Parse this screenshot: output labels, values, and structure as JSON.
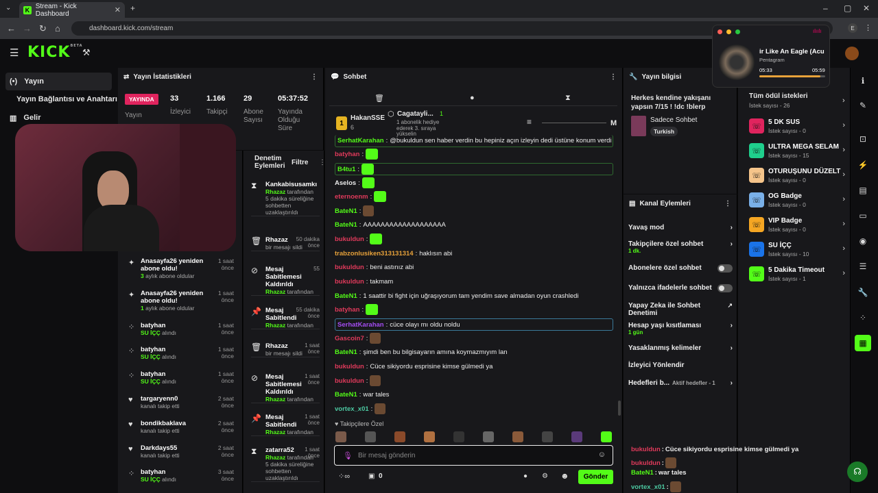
{
  "browser": {
    "tab_title": "Stream - Kick Dashboard",
    "url": "dashboard.kick.com/stream"
  },
  "app": {
    "logo": "KICK",
    "logo_badge": "BETA"
  },
  "leftnav": {
    "items": [
      {
        "label": "Yayın",
        "icon": "broadcast-icon"
      },
      {
        "label": "Yayın Bağlantısı ve Anahtarı",
        "icon": "key-icon"
      },
      {
        "label": "Gelir",
        "icon": "chart-icon"
      }
    ]
  },
  "stats": {
    "title": "Yayın İstatistikleri",
    "live_badge": "YAYINDA",
    "live_sub": "Yayın",
    "items": [
      {
        "value": "33",
        "label": "İzleyici"
      },
      {
        "value": "1.166",
        "label": "Takipçi"
      },
      {
        "value": "29",
        "label": "Abone Sayısı"
      },
      {
        "value": "05:37:52",
        "label": "Yayında Olduğu Süre"
      }
    ]
  },
  "events": [
    {
      "title": "Anasayfa26 yeniden abone oldu!",
      "sub_green": "3",
      "sub": " aylık abone oldular",
      "time": "1 saat önce",
      "icon": "sparkle-icon"
    },
    {
      "title": "Anasayfa26 yeniden abone oldu!",
      "sub_green": "1",
      "sub": " aylık abone oldular",
      "time": "1 saat önce",
      "icon": "sparkle-icon"
    },
    {
      "title": "batyhan",
      "sub_green": "SU İÇÇ",
      "sub": " alındı",
      "time": "1 saat önce",
      "icon": "reward-icon"
    },
    {
      "title": "batyhan",
      "sub_green": "SU İÇÇ",
      "sub": " alındı",
      "time": "1 saat önce",
      "icon": "reward-icon"
    },
    {
      "title": "batyhan",
      "sub_green": "SU İÇÇ",
      "sub": " alındı",
      "time": "1 saat önce",
      "icon": "reward-icon"
    },
    {
      "title": "targaryenn0",
      "sub_green": "",
      "sub": "kanalı takip etti",
      "time": "2 saat önce",
      "icon": "heart-icon"
    },
    {
      "title": "bondikbaklava",
      "sub_green": "",
      "sub": "kanalı takip etti",
      "time": "2 saat önce",
      "icon": "heart-icon"
    },
    {
      "title": "Darkdays55",
      "sub_green": "",
      "sub": "kanalı takip etti",
      "time": "2 saat önce",
      "icon": "heart-icon"
    },
    {
      "title": "batyhan",
      "sub_green": "SU İÇÇ",
      "sub": " alındı",
      "time": "3 saat önce",
      "icon": "reward-icon"
    }
  ],
  "moderation": {
    "title": "Denetim Eylemleri",
    "filter": "Filtre",
    "items": [
      {
        "icon": "hourglass-icon",
        "title": "Kankabisusamkı",
        "actor": "Rhazaz",
        "desc": " tarafından 5 dakika süreliğine sohbetten uzaklaştırıldı",
        "time": ""
      },
      {
        "icon": "trash-icon",
        "title": "Rhazaz",
        "actor": "",
        "desc": "bir mesajı sildi",
        "time": "50 dakika önce"
      },
      {
        "icon": "unpin-icon",
        "title": "Mesaj Sabitlemesi Kaldırıldı",
        "actor": "Rhazaz",
        "desc": " tarafından",
        "time": "55"
      },
      {
        "icon": "pin-icon",
        "title": "Mesaj Sabitlendi",
        "actor": "Rhazaz",
        "desc": " tarafından",
        "time": "55 dakika önce"
      },
      {
        "icon": "trash-icon",
        "title": "Rhazaz",
        "actor": "",
        "desc": "bir mesajı sildi",
        "time": "1 saat önce"
      },
      {
        "icon": "unpin-icon",
        "title": "Mesaj Sabitlemesi Kaldırıldı",
        "actor": "Rhazaz",
        "desc": " tarafından",
        "time": "1 saat önce"
      },
      {
        "icon": "pin-icon",
        "title": "Mesaj Sabitlendi",
        "actor": "Rhazaz",
        "desc": " tarafından",
        "time": "1 saat önce"
      },
      {
        "icon": "hourglass-icon",
        "title": "zatarra52",
        "actor": "Rhazaz",
        "desc": " tarafından 5 dakika süreliğine sohbetten uzaklaştırıldı",
        "time": "1 saat önce"
      }
    ]
  },
  "chat": {
    "title": "Sohbet",
    "top_user": "HakanSSE",
    "top_user_rank": "1",
    "top_user_count": "6",
    "gift_user": "Cagatayli...",
    "gift_text": "1 abonelik hediye ederek 3. sıraya yükselin",
    "gift_count": "1",
    "partial_letter": "M",
    "messages": [
      {
        "user": "SerhatKarahan",
        "color": "green",
        "text": "@bukuldun sen haber verdin bu hepiniz açın izleyin dedi üstüne konum verdi",
        "highlight": true
      },
      {
        "user": "batyhan",
        "color": "red",
        "text": "",
        "emote": true
      },
      {
        "user": "B4tu1",
        "color": "green",
        "text": "",
        "emote": true,
        "highlight": true
      },
      {
        "user": "Aselos",
        "color": "white",
        "text": "",
        "emote": true
      },
      {
        "user": "eternoenm",
        "color": "red",
        "text": "",
        "emote": true
      },
      {
        "user": "BateN1",
        "color": "green",
        "text": "",
        "avatar": true
      },
      {
        "user": "BateN1",
        "color": "green",
        "text": "AAAAAAAAAAAAAAAAAAA"
      },
      {
        "user": "bukuldun",
        "color": "red",
        "text": "",
        "emote": true
      },
      {
        "user": "trabzonlusiken313131314",
        "color": "orange",
        "text": "haklısın abi"
      },
      {
        "user": "bukuldun",
        "color": "red",
        "text": "beni astınız abi"
      },
      {
        "user": "bukuldun",
        "color": "red",
        "text": "takmam"
      },
      {
        "user": "BateN1",
        "color": "green",
        "text": "1 saattir bi fight için uğraşıyorum tam yendim save almadan oyun crashledi"
      },
      {
        "user": "batyhan",
        "color": "red",
        "text": "",
        "emote": true
      },
      {
        "user": "SerhatKarahan",
        "color": "purple",
        "text": "cüce olayı mı oldu noldu",
        "highlight": true
      },
      {
        "user": "Gascoin7",
        "color": "red",
        "text": "",
        "avatar": true
      },
      {
        "user": "BateN1",
        "color": "green",
        "text": "şimdi ben bu bilgisayarın amına koymazmıyım lan"
      },
      {
        "user": "bukuldun",
        "color": "red",
        "text": "Cüce sikiyordu esprisine kimse gülmedi ya"
      },
      {
        "user": "bukuldun",
        "color": "red",
        "text": "",
        "avatar": true
      },
      {
        "user": "BateN1",
        "color": "green",
        "text": "war tales"
      },
      {
        "user": "vortex_x01",
        "color": "teal",
        "text": "",
        "avatar": true
      }
    ],
    "followers_label": "Takipçilere Özel",
    "input_placeholder": "Bir mesaj gönderin",
    "points": "0",
    "send": "Gönder"
  },
  "stream_info": {
    "title": "Yayın bilgisi",
    "stream_title": "Herkes kendine yakışanı yapsın 7/15 ! !dc !blerp",
    "category": "Sadece Sohbet",
    "tag": "Turkish"
  },
  "channel_actions": {
    "title": "Kanal Eylemleri",
    "items": [
      {
        "label": "Yavaş mod",
        "type": "arrow",
        "sub": ""
      },
      {
        "label": "Takipçilere özel sohbet",
        "type": "arrow",
        "sub": "1 dk."
      },
      {
        "label": "Abonelere özel sohbet",
        "type": "toggle",
        "sub": ""
      },
      {
        "label": "Yalnızca ifadelerle sohbet",
        "type": "toggle",
        "sub": ""
      },
      {
        "label": "Yapay Zeka ile Sohbet Denetimi",
        "type": "external",
        "sub": ""
      },
      {
        "label": "Hesap yaşı kısıtlaması",
        "type": "arrow",
        "sub": "1 gün"
      },
      {
        "label": "Yasaklanmış kelimeler",
        "type": "arrow",
        "sub": ""
      },
      {
        "label": "İzleyici Yönlendir",
        "type": "none",
        "sub": ""
      },
      {
        "label": "Hedefleri b...",
        "type": "arrow",
        "sub": "Aktif hedefler - 1"
      }
    ]
  },
  "rewards": {
    "all_label": "Tüm ödül istekleri",
    "all_count": "İstek sayısı - 26",
    "items": [
      {
        "name": "5 DK SUS",
        "count": "İstek sayısı - 0",
        "color": "#e0245e"
      },
      {
        "name": "ULTRA MEGA SELAM",
        "count": "İstek sayısı - 15",
        "color": "#1fcf8c"
      },
      {
        "name": "OTURUŞUNU DÜZELT",
        "count": "İstek sayısı - 0",
        "color": "#f5c48a"
      },
      {
        "name": "OG Badge",
        "count": "İstek sayısı - 0",
        "color": "#7ab0e8"
      },
      {
        "name": "VIP Badge",
        "count": "İstek sayısı - 0",
        "color": "#f5a623"
      },
      {
        "name": "SU İÇÇ",
        "count": "İstek sayısı - 10",
        "color": "#1a73e8"
      },
      {
        "name": "5 Dakika Timeout",
        "count": "İstek sayısı - 1",
        "color": "#53fc18"
      }
    ]
  },
  "music": {
    "title": "ir Like An Eagle (Acu",
    "artist": "Pentagram",
    "elapsed": "05:33",
    "total": "05:59",
    "progress": 0.93
  },
  "overlay_chat": [
    {
      "user": "bukuldun",
      "text": "Cüce sikiyordu esprisine kimse gülmedi ya"
    },
    {
      "user": "bukuldun",
      "text": ""
    },
    {
      "user": "BateN1",
      "text": "war tales"
    },
    {
      "user": "vortex_x01",
      "text": ""
    }
  ]
}
